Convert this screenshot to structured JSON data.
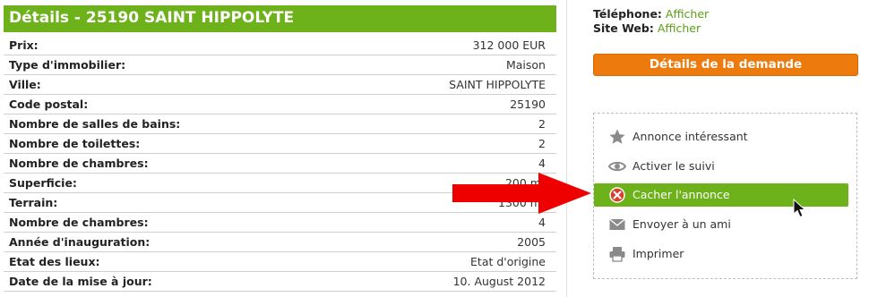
{
  "title": "Détails - 25190 SAINT HIPPOLYTE",
  "details": [
    {
      "label": "Prix:",
      "value": "312 000 EUR"
    },
    {
      "label": "Type d'immobilier:",
      "value": "Maison"
    },
    {
      "label": "Ville:",
      "value": "SAINT HIPPOLYTE"
    },
    {
      "label": "Code postal:",
      "value": "25190"
    },
    {
      "label": "Nombre de salles de bains:",
      "value": "2"
    },
    {
      "label": "Nombre de toilettes:",
      "value": "2"
    },
    {
      "label": "Nombre de chambres:",
      "value": "4"
    },
    {
      "label": "Superficie:",
      "value": "200 m²"
    },
    {
      "label": "Terrain:",
      "value": "1300 m²"
    },
    {
      "label": "Nombre de chambres:",
      "value": "4"
    },
    {
      "label": "Année d'inauguration:",
      "value": "2005"
    },
    {
      "label": "Etat des lieux:",
      "value": "Etat d'origine"
    },
    {
      "label": "Date de la mise à jour:",
      "value": "10. August 2012"
    }
  ],
  "contact": {
    "phone_label": "Téléphone:",
    "phone_link": "Afficher",
    "web_label": "Site Web:",
    "web_link": "Afficher"
  },
  "demand_button": "Détails de la demande",
  "actions": [
    {
      "label": "Annonce intéressant",
      "icon": "star-icon"
    },
    {
      "label": "Activer le suivi",
      "icon": "eye-icon"
    },
    {
      "label": "Cacher l'annonce",
      "icon": "hide-icon",
      "active": true
    },
    {
      "label": "Envoyer à un ami",
      "icon": "envelope-icon"
    },
    {
      "label": "Imprimer",
      "icon": "printer-icon"
    }
  ],
  "colors": {
    "green": "#6db11b",
    "orange": "#ec7a0c",
    "link_green": "#5aa014",
    "arrow_red": "#ee0000"
  }
}
